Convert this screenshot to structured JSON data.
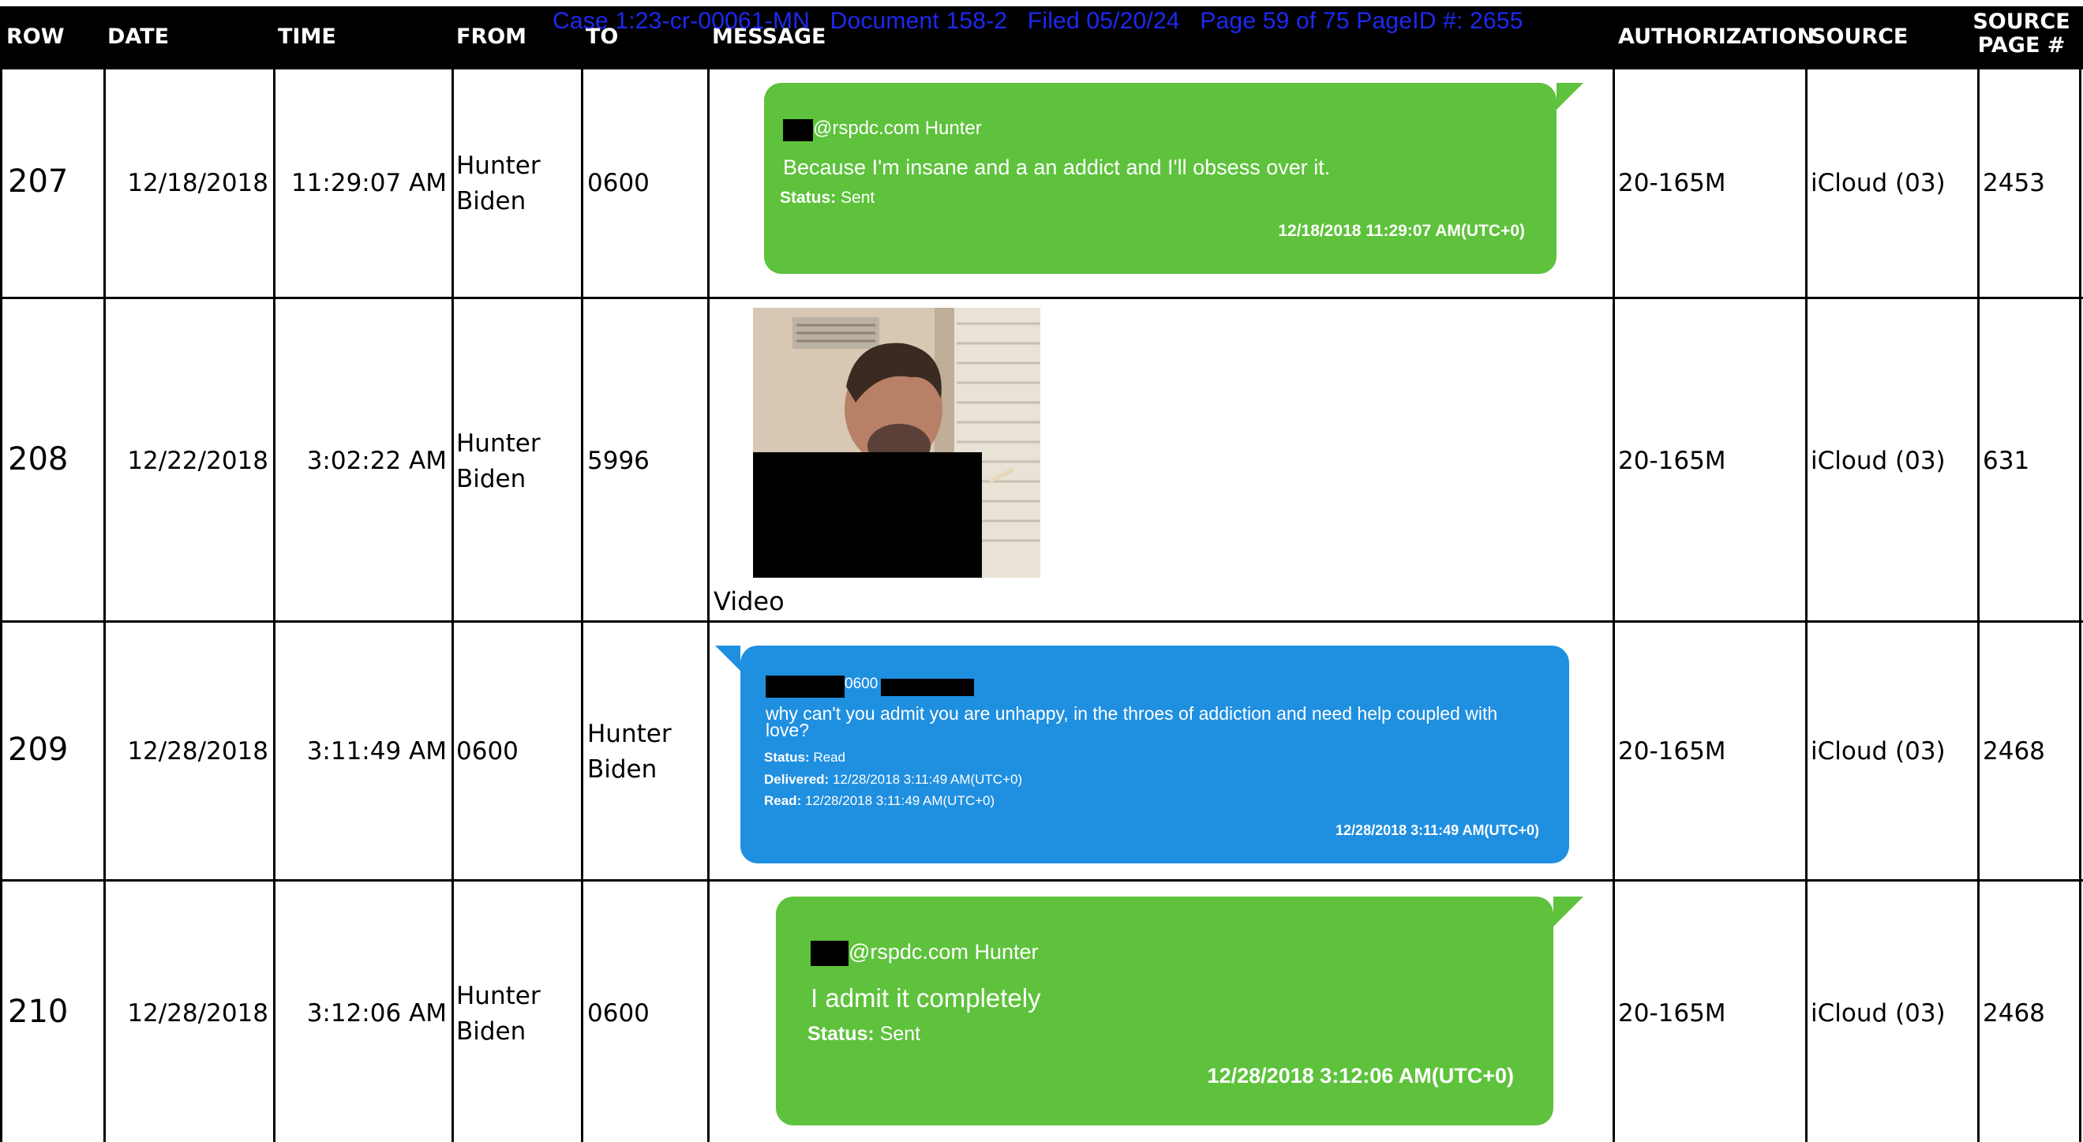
{
  "stamp": "Case 1:23-cr-00061-MN   Document 158-2   Filed 05/20/24   Page 59 of 75 PageID #: 2655",
  "headers": {
    "row": "ROW",
    "date": "DATE",
    "time": "TIME",
    "from": "FROM",
    "to": "TO",
    "message": "MESSAGE",
    "authorization": "AUTHORIZATION",
    "source": "SOURCE",
    "source_page_line1": "SOURCE",
    "source_page_line2": "PAGE #"
  },
  "rows": [
    {
      "row": "207",
      "date": "12/18/2018",
      "time": "11:29:07 AM",
      "from_line1": "Hunter",
      "from_line2": "Biden",
      "to": "0600",
      "authorization": "20-165M",
      "source": "iCloud (03)",
      "source_page": "2453",
      "message": {
        "type": "sent",
        "sender": "@rspdc.com Hunter",
        "text": "Because I'm insane and a an addict and I'll obsess over it.",
        "status_label": "Status:",
        "status_value": "Sent",
        "timestamp": "12/18/2018 11:29:07 AM(UTC+0)"
      }
    },
    {
      "row": "208",
      "date": "12/22/2018",
      "time": "3:02:22 AM",
      "from_line1": "Hunter",
      "from_line2": "Biden",
      "to": "5996",
      "authorization": "20-165M",
      "source": "iCloud (03)",
      "source_page": "631",
      "message": {
        "type": "video",
        "caption": "Video"
      }
    },
    {
      "row": "209",
      "date": "12/28/2018",
      "time": "3:11:49 AM",
      "from_line1": "0600",
      "from_line2": "",
      "to_line1": "Hunter",
      "to_line2": "Biden",
      "authorization": "20-165M",
      "source": "iCloud (03)",
      "source_page": "2468",
      "message": {
        "type": "received",
        "sender_fragment": "0600",
        "text": "why can't you admit you are unhappy,  in the throes of addiction and need help coupled with love?",
        "status_label": "Status:",
        "status_value": "Read",
        "delivered_label": "Delivered:",
        "delivered_value": "12/28/2018 3:11:49 AM(UTC+0)",
        "read_label": "Read:",
        "read_value": "12/28/2018 3:11:49 AM(UTC+0)",
        "timestamp": "12/28/2018 3:11:49 AM(UTC+0)"
      }
    },
    {
      "row": "210",
      "date": "12/28/2018",
      "time": "3:12:06 AM",
      "from_line1": "Hunter",
      "from_line2": "Biden",
      "to": "0600",
      "authorization": "20-165M",
      "source": "iCloud (03)",
      "source_page": "2468",
      "message": {
        "type": "sent",
        "sender": "@rspdc.com Hunter",
        "text": "I admit it completely",
        "status_label": "Status:",
        "status_value": "Sent",
        "timestamp": "12/28/2018 3:12:06 AM(UTC+0)"
      }
    }
  ],
  "colors": {
    "sent_bubble": "#5ec23c",
    "received_bubble": "#1f8fe0",
    "stamp": "#1f2cff",
    "header_bg": "#000000"
  }
}
